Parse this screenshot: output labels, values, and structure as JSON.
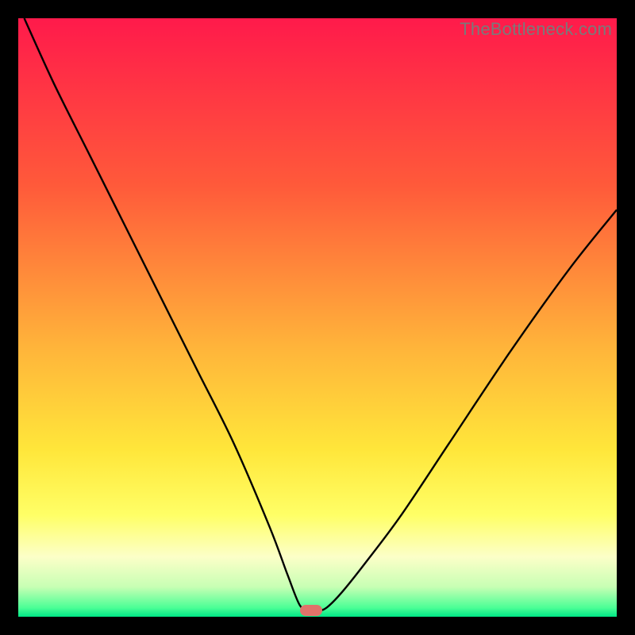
{
  "watermark": "TheBottleneck.com",
  "colors": {
    "frame": "#000000",
    "curve_stroke": "#000000",
    "marker": "#e0736a",
    "gradient_stops": [
      {
        "at": 0,
        "color": "#ff1a4b"
      },
      {
        "at": 28,
        "color": "#ff5a3a"
      },
      {
        "at": 55,
        "color": "#ffb43a"
      },
      {
        "at": 72,
        "color": "#ffe63a"
      },
      {
        "at": 83,
        "color": "#ffff66"
      },
      {
        "at": 90,
        "color": "#fcffc8"
      },
      {
        "at": 95,
        "color": "#c8ffb4"
      },
      {
        "at": 98.5,
        "color": "#4bff96"
      },
      {
        "at": 100,
        "color": "#00e686"
      }
    ]
  },
  "chart_data": {
    "type": "line",
    "title": "",
    "xlabel": "",
    "ylabel": "",
    "xlim": [
      0,
      100
    ],
    "ylim": [
      0,
      100
    ],
    "grid": false,
    "legend": false,
    "annotations": [],
    "minimum": {
      "x": 49,
      "y": 1
    },
    "x": [
      1,
      6,
      12,
      18,
      24,
      30,
      36,
      42,
      45,
      47,
      48.5,
      50,
      51.5,
      54,
      58,
      64,
      72,
      82,
      92,
      100
    ],
    "series": [
      {
        "name": "bottleneck-curve",
        "values": [
          100,
          89,
          77,
          65,
          53,
          41,
          29,
          15,
          7,
          2,
          1,
          1,
          1.5,
          4,
          9,
          17,
          29,
          44,
          58,
          68
        ]
      }
    ]
  }
}
